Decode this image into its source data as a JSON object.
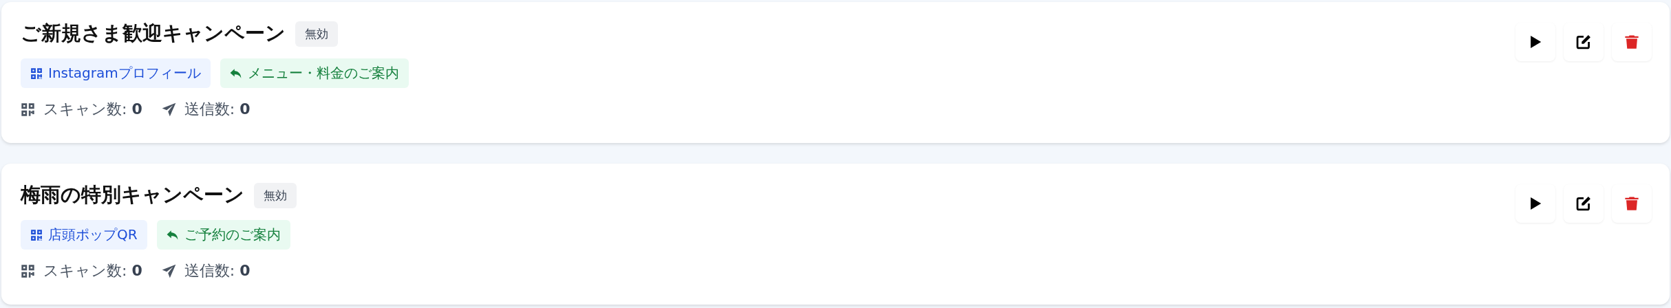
{
  "campaigns": [
    {
      "title": "ご新規さま歓迎キャンペーン",
      "status": {
        "label": "無効",
        "active": false
      },
      "tags": [
        {
          "kind": "qr",
          "label": "Instagramプロフィール"
        },
        {
          "kind": "reply",
          "label": "メニュー・料金のご案内"
        }
      ],
      "stats": [
        {
          "kind": "scan",
          "text": "スキャン数: **0**"
        },
        {
          "kind": "send",
          "text": "送信数: **0**"
        }
      ],
      "actions": [
        {
          "kind": "play"
        },
        {
          "kind": "edit"
        },
        {
          "kind": "delete"
        }
      ]
    },
    {
      "title": "梅雨の特別キャンペーン",
      "status": {
        "label": "無効",
        "active": false
      },
      "tags": [
        {
          "kind": "qr",
          "label": "店頭ポップQR"
        },
        {
          "kind": "reply",
          "label": "ご予約のご案内"
        }
      ],
      "stats": [
        {
          "kind": "scan",
          "text": "スキャン数: **0**"
        },
        {
          "kind": "send",
          "text": "送信数: **0**"
        }
      ],
      "actions": [
        {
          "kind": "play"
        },
        {
          "kind": "edit"
        },
        {
          "kind": "delete"
        }
      ]
    }
  ]
}
